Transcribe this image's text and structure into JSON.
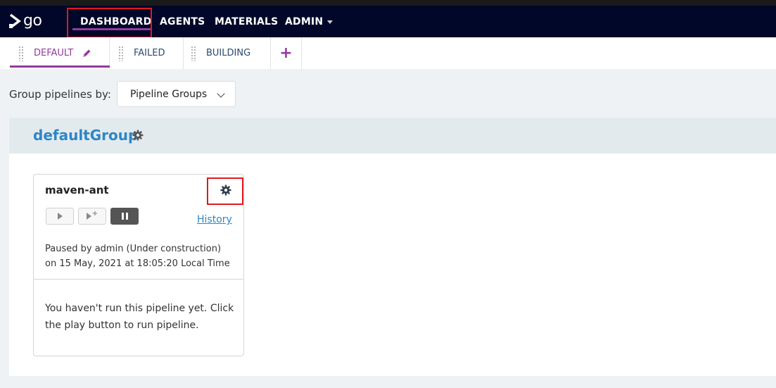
{
  "app": {
    "logo_text": "go"
  },
  "nav": {
    "dashboard": "DASHBOARD",
    "agents": "AGENTS",
    "materials": "MATERIALS",
    "admin": "ADMIN"
  },
  "tabs": {
    "default": "DEFAULT",
    "failed": "FAILED",
    "building": "BUILDING",
    "add": "+"
  },
  "grouping": {
    "label": "Group pipelines by:",
    "selected": "Pipeline Groups"
  },
  "group": {
    "name": "defaultGroup"
  },
  "pipeline": {
    "name": "maven-ant",
    "history_label": "History",
    "paused_line1": "Paused by admin (Under construction)",
    "paused_line2": "on 15 May, 2021 at 18:05:20 Local Time",
    "empty_line1": "You haven't run this pipeline yet. Click",
    "empty_line2": "the play button to run pipeline."
  },
  "colors": {
    "header_bg": "#000728",
    "accent": "#943a9e",
    "link": "#2d86c5",
    "highlight": "#e0191e"
  }
}
